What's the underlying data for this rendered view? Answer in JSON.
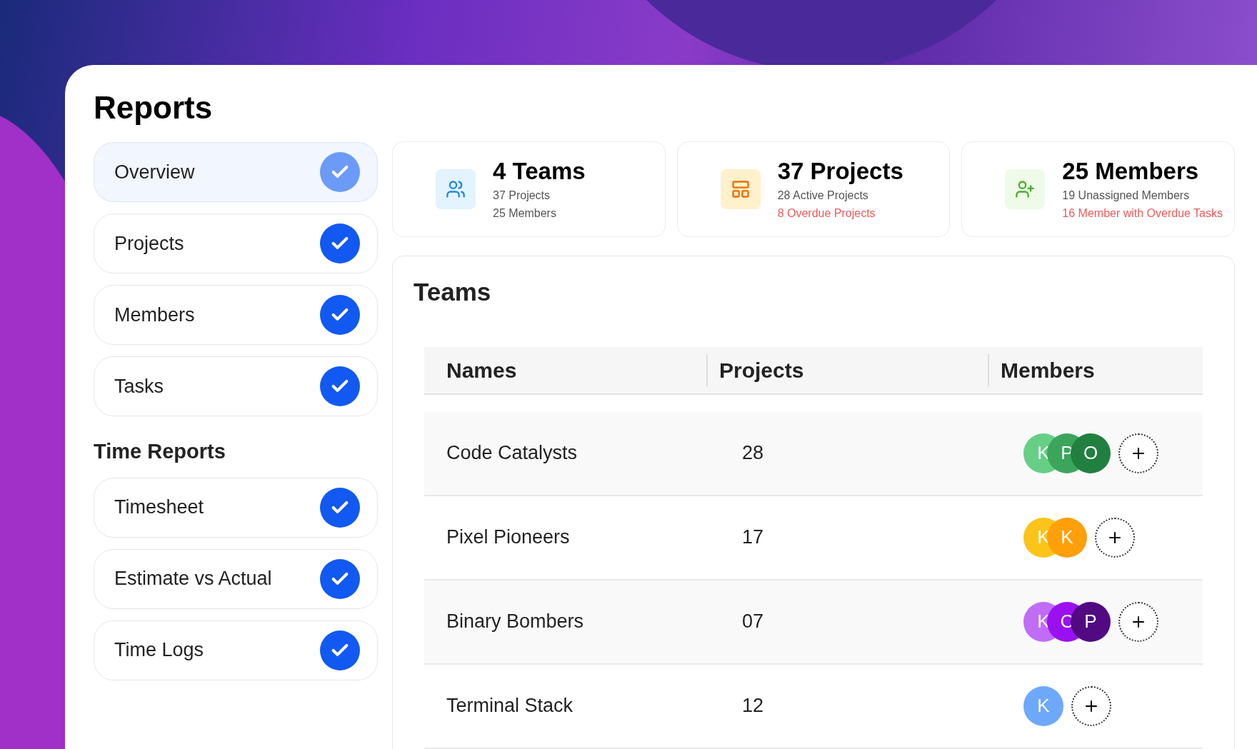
{
  "title": "Reports",
  "nav": [
    {
      "label": "Overview",
      "selected": true
    },
    {
      "label": "Projects",
      "selected": false
    },
    {
      "label": "Members",
      "selected": false
    },
    {
      "label": "Tasks",
      "selected": false
    }
  ],
  "time_reports": {
    "heading": "Time Reports",
    "items": [
      {
        "label": "Timesheet",
        "selected": false
      },
      {
        "label": "Estimate vs Actual",
        "selected": false
      },
      {
        "label": "Time Logs",
        "selected": false
      }
    ]
  },
  "stats": [
    {
      "kind": "teams",
      "title": "4 Teams",
      "lines": [
        {
          "text": "37 Projects",
          "alert": false
        },
        {
          "text": "25 Members",
          "alert": false
        }
      ]
    },
    {
      "kind": "projects",
      "title": "37 Projects",
      "lines": [
        {
          "text": "28 Active Projects",
          "alert": false
        },
        {
          "text": "8 Overdue Projects",
          "alert": true
        }
      ]
    },
    {
      "kind": "members",
      "title": "25 Members",
      "lines": [
        {
          "text": "19 Unassigned Members",
          "alert": false
        },
        {
          "text": "16 Member with Overdue Tasks",
          "alert": true
        }
      ]
    }
  ],
  "teams": {
    "heading": "Teams",
    "columns": [
      "Names",
      "Projects",
      "Members"
    ],
    "rows": [
      {
        "name": "Code Catalysts",
        "projects": "28",
        "members": [
          {
            "initial": "K",
            "color": "#66cf85"
          },
          {
            "initial": "P",
            "color": "#3ba55c"
          },
          {
            "initial": "O",
            "color": "#217f3f"
          }
        ]
      },
      {
        "name": "Pixel Pioneers",
        "projects": "17",
        "members": [
          {
            "initial": "K",
            "color": "#fcc419"
          },
          {
            "initial": "K",
            "color": "#ff9f0a"
          }
        ]
      },
      {
        "name": "Binary Bombers",
        "projects": "07",
        "members": [
          {
            "initial": "K",
            "color": "#c06cf5"
          },
          {
            "initial": "C",
            "color": "#9b10f0"
          },
          {
            "initial": "P",
            "color": "#520a82"
          }
        ]
      },
      {
        "name": "Terminal Stack",
        "projects": "12",
        "members": [
          {
            "initial": "K",
            "color": "#6ea8fa"
          }
        ]
      }
    ]
  }
}
